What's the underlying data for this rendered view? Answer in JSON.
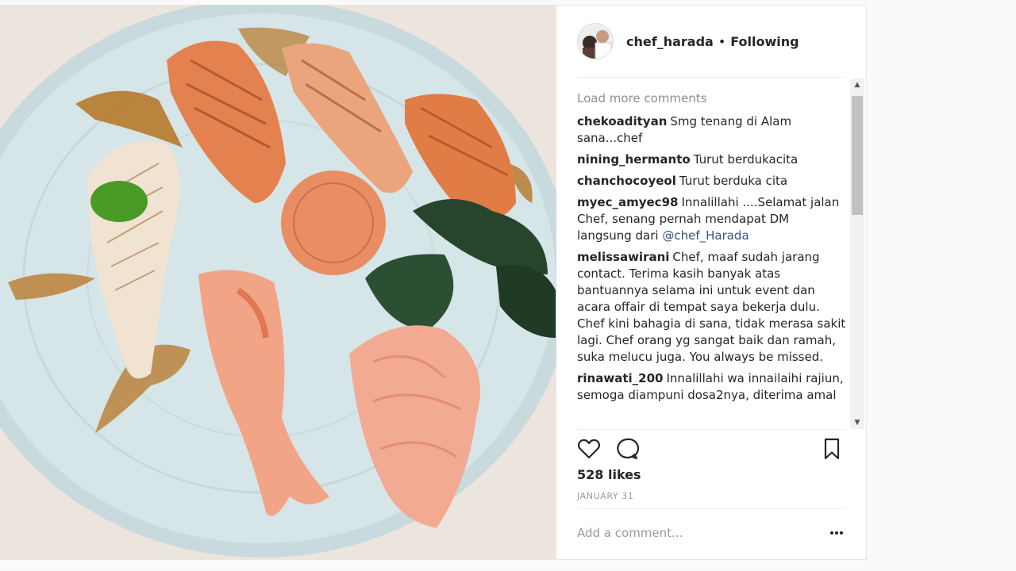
{
  "post": {
    "photo": {
      "icon": "sushi-plate-photo"
    },
    "header": {
      "username": "chef_harada",
      "separator": "•",
      "follow_state": "Following",
      "avatar_icon": "avatar-photo"
    },
    "comments": {
      "load_more": "Load more comments",
      "items": [
        {
          "user": "chekoadityan",
          "text": "Smg tenang di Alam sana...chef"
        },
        {
          "user": "nining_hermanto",
          "text": "Turut berdukacita"
        },
        {
          "user": "chanchocoyeol",
          "text": "Turut berduka cita"
        },
        {
          "user": "myec_amyec98",
          "text": "Innalillahi ....Selamat jalan Chef, senang pernah mendapat DM langsung dari",
          "mention": "@chef_Harada"
        },
        {
          "user": "melissawirani",
          "text": "Chef, maaf sudah jarang contact. Terima kasih banyak atas bantuannya selama ini untuk event dan acara offair di tempat saya bekerja dulu. Chef kini bahagia di sana, tidak merasa sakit lagi. Chef orang yg sangat baik dan ramah, suka melucu juga. You always be missed."
        },
        {
          "user": "rinawati_200",
          "text": "Innalillahi wa innailaihi rajiun, semoga diampuni dosa2nya, diterima amal"
        }
      ]
    },
    "scrollbar": {
      "up_icon": "▲",
      "down_icon": "▼"
    },
    "actions": {
      "like_icon": "heart-icon",
      "comment_icon": "comment-bubble-icon",
      "save_icon": "bookmark-icon"
    },
    "likes": "528 likes",
    "date": "JANUARY 31",
    "add_comment": {
      "placeholder": "Add a comment...",
      "more_icon": "ellipsis-icon"
    }
  }
}
